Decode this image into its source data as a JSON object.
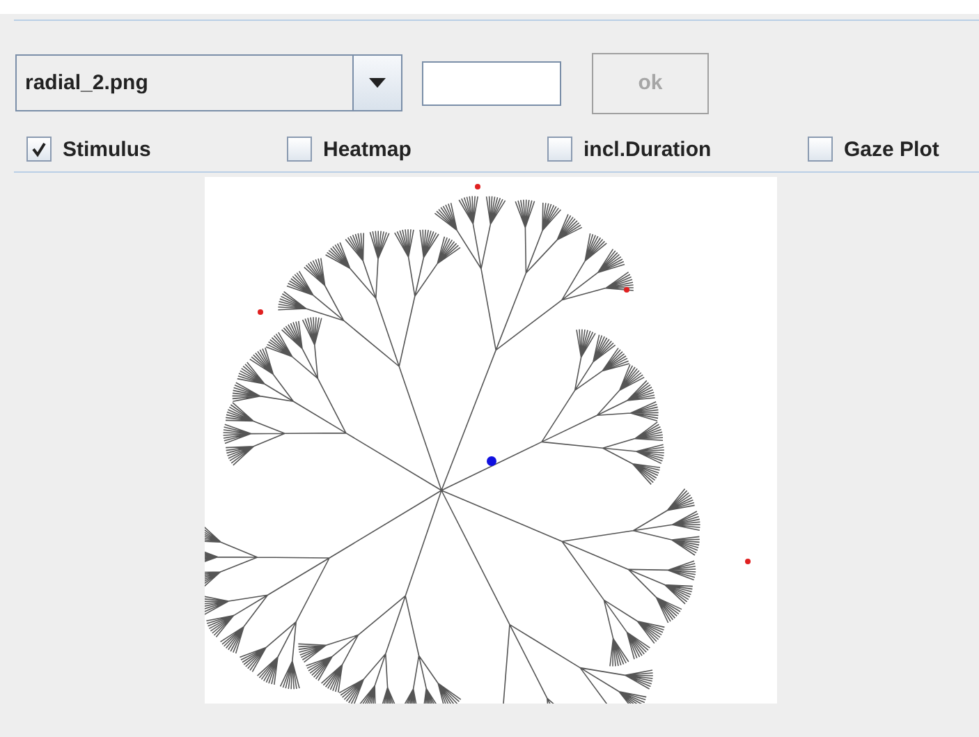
{
  "file_select": {
    "value": "radial_2.png"
  },
  "ok_button": {
    "label": "ok",
    "disabled": true
  },
  "checkboxes": [
    {
      "label": "Stimulus",
      "checked": true
    },
    {
      "label": "Heatmap",
      "checked": false
    },
    {
      "label": "incl.Duration",
      "checked": false
    },
    {
      "label": "Gaze Plot",
      "checked": false
    }
  ]
}
